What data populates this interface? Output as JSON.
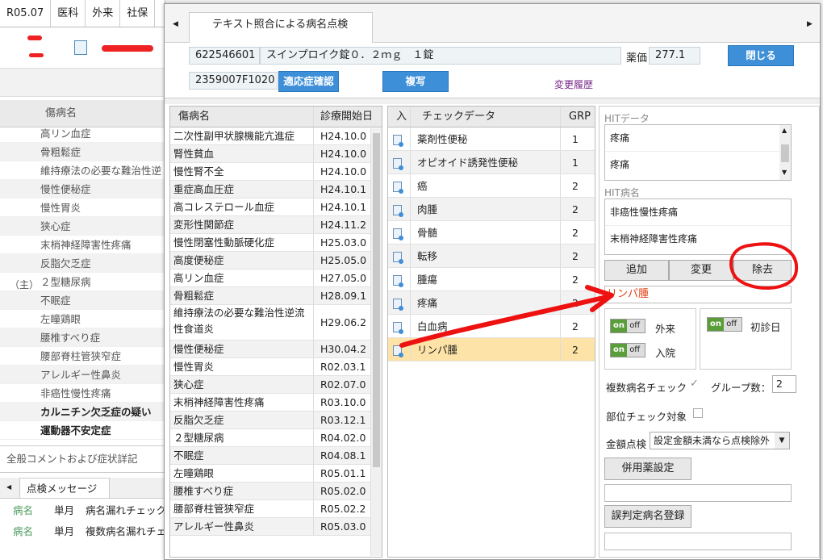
{
  "bg": {
    "tabs": [
      "R05.07",
      "医科",
      "外来",
      "社保"
    ],
    "header": "傷病名",
    "main_label": "（主）",
    "diseases": [
      {
        "t": "高リン血症"
      },
      {
        "t": "骨粗鬆症"
      },
      {
        "t": "維持療法の必要な難治性逆"
      },
      {
        "t": "慢性便秘症"
      },
      {
        "t": "慢性胃炎"
      },
      {
        "t": "狭心症"
      },
      {
        "t": "末梢神経障害性疼痛"
      },
      {
        "t": "反脂欠乏症"
      },
      {
        "t": "２型糖尿病"
      },
      {
        "t": "不眠症"
      },
      {
        "t": "左瞳鶏眼"
      },
      {
        "t": "腰椎すべり症"
      },
      {
        "t": "腰部脊柱管狭窄症"
      },
      {
        "t": "アレルギー性鼻炎"
      },
      {
        "t": "非癌性慢性疼痛"
      },
      {
        "t": "カルニチン欠乏症の疑い"
      },
      {
        "t": "運動器不安定症"
      }
    ],
    "comment": "全般コメントおよび症状詳記",
    "msg_tab": "点検メッセージ",
    "msg_rows": [
      {
        "a": "病名",
        "b": "単月",
        "c": "病名漏れチェック"
      },
      {
        "a": "病名",
        "b": "単月",
        "c": "複数病名漏れチェ"
      }
    ]
  },
  "dialog": {
    "tab": "テキスト照合による病名点検",
    "drug_code": "622546601",
    "drug_name": "スインプロイク錠０．２ｍｇ　１錠",
    "price_label": "薬価",
    "price": "277.1",
    "close": "閉じる",
    "ycode": "2359007F1020",
    "confirm": "適応症確認",
    "copy": "複写",
    "history": "変更履歴"
  },
  "disease_table": {
    "headers": [
      "傷病名",
      "診療開始日"
    ],
    "rows": [
      {
        "n": "二次性副甲状腺機能亢進症",
        "d": "H24.10.0"
      },
      {
        "n": "腎性貧血",
        "d": "H24.10.0"
      },
      {
        "n": "慢性腎不全",
        "d": "H24.10.0"
      },
      {
        "n": "重症高血圧症",
        "d": "H24.10.1"
      },
      {
        "n": "高コレステロール血症",
        "d": "H24.10.1"
      },
      {
        "n": "変形性関節症",
        "d": "H24.11.2"
      },
      {
        "n": "慢性閉塞性動脈硬化症",
        "d": "H25.03.0"
      },
      {
        "n": "高度便秘症",
        "d": "H25.05.0"
      },
      {
        "n": "高リン血症",
        "d": "H27.05.0"
      },
      {
        "n": "骨粗鬆症",
        "d": "H28.09.1"
      },
      {
        "n": "維持療法の必要な難治性逆流性食道炎",
        "d": "H29.06.2"
      },
      {
        "n": "慢性便秘症",
        "d": "H30.04.2"
      },
      {
        "n": "慢性胃炎",
        "d": "R02.03.1"
      },
      {
        "n": "狭心症",
        "d": "R02.07.0"
      },
      {
        "n": "末梢神経障害性疼痛",
        "d": "R03.10.0"
      },
      {
        "n": "反脂欠乏症",
        "d": "R03.12.1"
      },
      {
        "n": "２型糖尿病",
        "d": "R04.02.0"
      },
      {
        "n": "不眠症",
        "d": "R04.08.1"
      },
      {
        "n": "左瞳鶏眼",
        "d": "R05.01.1"
      },
      {
        "n": "腰椎すべり症",
        "d": "R05.02.0"
      },
      {
        "n": "腰部脊柱管狭窄症",
        "d": "R05.02.2"
      },
      {
        "n": "アレルギー性鼻炎",
        "d": "R05.03.0"
      }
    ]
  },
  "check_table": {
    "headers": [
      "入",
      "チェックデータ",
      "GRP"
    ],
    "rows": [
      {
        "n": "薬剤性便秘",
        "g": "1"
      },
      {
        "n": "オピオイド誘発性便秘",
        "g": "1"
      },
      {
        "n": "癌",
        "g": "2"
      },
      {
        "n": "肉腫",
        "g": "2"
      },
      {
        "n": "骨髄",
        "g": "2"
      },
      {
        "n": "転移",
        "g": "2"
      },
      {
        "n": "腫瘍",
        "g": "2"
      },
      {
        "n": "疼痛",
        "g": "2"
      },
      {
        "n": "白血病",
        "g": "2"
      },
      {
        "n": "リンパ腫",
        "g": "2"
      }
    ]
  },
  "right": {
    "hit_data_label": "HITデータ",
    "hit_data": [
      "疼痛",
      "疼痛"
    ],
    "hit_disease_label": "HIT病名",
    "hit_diseases": [
      "非癌性慢性疼痛",
      "末梢神経障害性疼痛"
    ],
    "add": "追加",
    "change": "変更",
    "remove": "除去",
    "selected": "リンパ腫",
    "on": "on",
    "off": "off",
    "outpatient": "外来",
    "first_visit": "初診日",
    "inpatient": "入院",
    "multi_check": "複数病名チェック",
    "check_mark": "✓",
    "group_count_label": "グループ数：",
    "group_count": "2",
    "site_check": "部位チェック対象",
    "amount_label": "金額点検",
    "amount_value": "設定金額未満なら点検除外",
    "combo_btn": "併用薬設定",
    "misjudge_btn": "誤判定病名登録"
  },
  "colors": {
    "accent": "#3d8fd8",
    "highlight": "#fde3a7",
    "annotation": "#ee1111"
  }
}
